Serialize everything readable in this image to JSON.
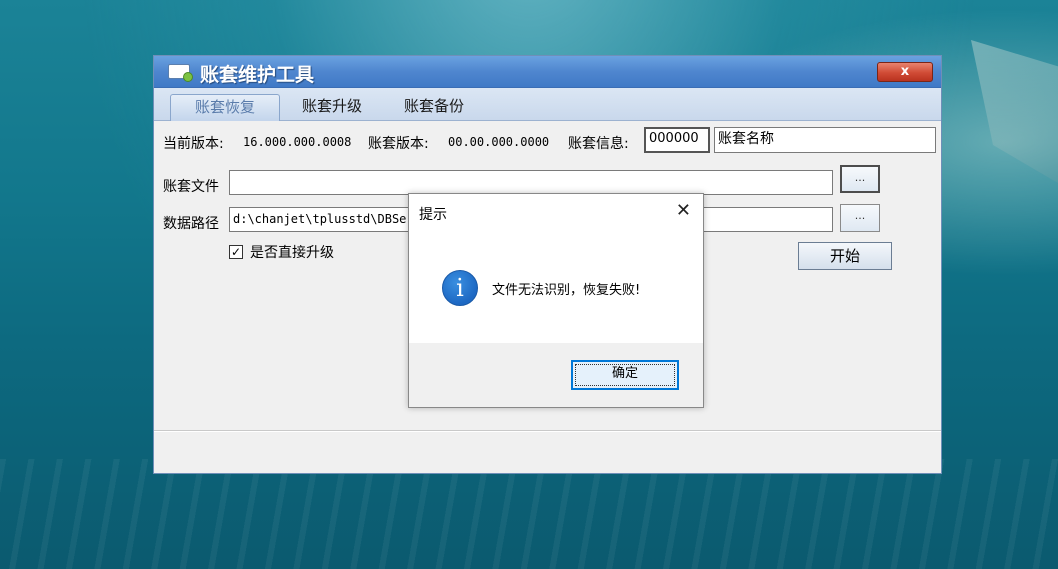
{
  "window": {
    "title": "账套维护工具",
    "close_label": "x"
  },
  "tabs": [
    {
      "label": "账套恢复",
      "active": true
    },
    {
      "label": "账套升级",
      "active": false
    },
    {
      "label": "账套备份",
      "active": false
    }
  ],
  "info_row": {
    "current_version_label": "当前版本:",
    "current_version_value": "16.000.000.0008",
    "account_version_label": "账套版本:",
    "account_version_value": "00.00.000.0000",
    "account_info_label": "账套信息:",
    "account_code": "000000",
    "account_name": "账套名称"
  },
  "form": {
    "account_file_label": "账套文件",
    "account_file_value": "",
    "browse_label": "...",
    "data_path_label": "数据路径",
    "data_path_value": "d:\\chanjet\\tplusstd\\DBServer\\Data",
    "direct_upgrade_label": "是否直接升级",
    "direct_upgrade_checked": true,
    "check_glyph": "✓",
    "start_label": "开始"
  },
  "dialog": {
    "title": "提示",
    "close_glyph": "✕",
    "icon": "info-icon",
    "icon_glyph": "i",
    "message": "文件无法识别，恢复失败!",
    "ok_label": "确定"
  },
  "colors": {
    "titlebar": "#4f86cf",
    "close_button": "#d04b35",
    "info_icon": "#1d68c3",
    "focus_border": "#0078d7"
  }
}
